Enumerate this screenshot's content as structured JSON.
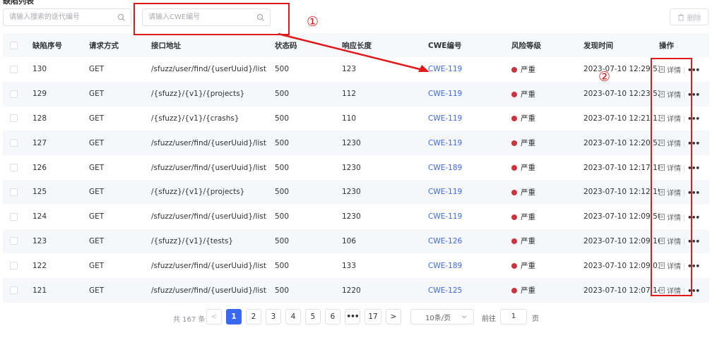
{
  "page": {
    "title": "缺陷列表"
  },
  "filters": {
    "iteration_placeholder": "请输入搜索的迭代编号",
    "cwe_placeholder": "请输入CWE编号"
  },
  "toolbar": {
    "delete_label": "删除"
  },
  "annotations": {
    "marker1": "①",
    "marker2": "②",
    "highlight_color": "#e0191b"
  },
  "table": {
    "columns": [
      "缺陷序号",
      "请求方式",
      "接口地址",
      "状态码",
      "响应长度",
      "CWE编号",
      "风险等级",
      "发现时间",
      "操作"
    ],
    "detail_label": "详情",
    "more_label": "•••",
    "rows": [
      {
        "id": "130",
        "method": "GET",
        "path": "/sfuzz/user/find/{userUuid}/list",
        "status": "500",
        "length": "123",
        "cwe": "CWE-119",
        "risk": "严重",
        "time": "2023-07-10 12:29:53"
      },
      {
        "id": "129",
        "method": "GET",
        "path": "/{sfuzz}/{v1}/{projects}",
        "status": "500",
        "length": "112",
        "cwe": "CWE-119",
        "risk": "严重",
        "time": "2023-07-10 12:23:52"
      },
      {
        "id": "128",
        "method": "GET",
        "path": "/{sfuzz}/{v1}/{crashs}",
        "status": "500",
        "length": "110",
        "cwe": "CWE-119",
        "risk": "严重",
        "time": "2023-07-10 12:21:13"
      },
      {
        "id": "127",
        "method": "GET",
        "path": "/sfuzz/user/find/{userUuid}/list",
        "status": "500",
        "length": "1230",
        "cwe": "CWE-119",
        "risk": "严重",
        "time": "2023-07-10 12:20:52"
      },
      {
        "id": "126",
        "method": "GET",
        "path": "/sfuzz/user/find/{userUuid}/list",
        "status": "500",
        "length": "1230",
        "cwe": "CWE-189",
        "risk": "严重",
        "time": "2023-07-10 12:17:18"
      },
      {
        "id": "125",
        "method": "GET",
        "path": "/{sfuzz}/{v1}/{projects}",
        "status": "500",
        "length": "1230",
        "cwe": "CWE-119",
        "risk": "严重",
        "time": "2023-07-10 12:12:19"
      },
      {
        "id": "124",
        "method": "GET",
        "path": "/sfuzz/user/find/{userUuid}/list",
        "status": "500",
        "length": "1230",
        "cwe": "CWE-119",
        "risk": "严重",
        "time": "2023-07-10 12:09:50"
      },
      {
        "id": "123",
        "method": "GET",
        "path": "/{sfuzz}/{v1}/{tests}",
        "status": "500",
        "length": "106",
        "cwe": "CWE-126",
        "risk": "严重",
        "time": "2023-07-10 12:09:16"
      },
      {
        "id": "122",
        "method": "GET",
        "path": "/sfuzz/user/find/{userUuid}/list",
        "status": "500",
        "length": "133",
        "cwe": "CWE-189",
        "risk": "严重",
        "time": "2023-07-10 12:09:03"
      },
      {
        "id": "121",
        "method": "GET",
        "path": "/sfuzz/user/find/{userUuid}/list",
        "status": "500",
        "length": "1220",
        "cwe": "CWE-125",
        "risk": "严重",
        "time": "2023-07-10 12:07:14"
      }
    ]
  },
  "pagination": {
    "total": "共 167 条",
    "prev": "<",
    "next": ">",
    "pages": [
      "1",
      "2",
      "3",
      "4",
      "5",
      "6"
    ],
    "ellipsis": "•••",
    "last": "17",
    "page_size": "10条/页",
    "goto_label": "前往",
    "goto_value": "1",
    "page_unit": "页"
  },
  "colors": {
    "accent": "#3a68ef",
    "risk_dot": "#c8363c",
    "stripe": "#f5f7fa"
  }
}
